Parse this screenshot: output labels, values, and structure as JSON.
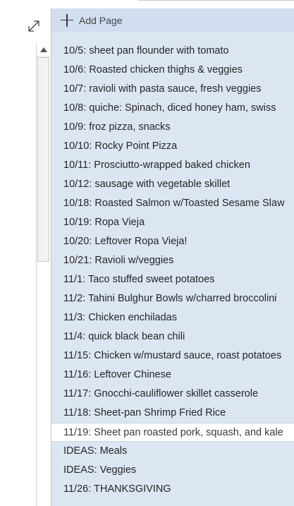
{
  "toolbar": {
    "add_page_label": "Add Page",
    "expand_icon": "expand-diagonal-arrows-icon"
  },
  "scrollbar": {
    "up_icon": "scroll-up-arrow-icon"
  },
  "pages": [
    {
      "title": "10/5: sheet pan flounder with tomato"
    },
    {
      "title": "10/6: Roasted chicken thighs & veggies"
    },
    {
      "title": "10/7: ravioli with pasta sauce, fresh veggies"
    },
    {
      "title": "10/8: quiche: Spinach, diced honey ham, swiss"
    },
    {
      "title": "10/9: froz pizza, snacks"
    },
    {
      "title": "10/10: Rocky Point Pizza"
    },
    {
      "title": "10/11: Prosciutto-wrapped baked chicken"
    },
    {
      "title": "10/12: sausage with vegetable skillet"
    },
    {
      "title": "10/18: Roasted Salmon w/Toasted Sesame Slaw"
    },
    {
      "title": "10/19: Ropa Vieja"
    },
    {
      "title": "10/20: Leftover Ropa Vieja!"
    },
    {
      "title": "10/21: Ravioli w/veggies"
    },
    {
      "title": "11/1: Taco stuffed sweet potatoes"
    },
    {
      "title": "11/2: Tahini Bulghur Bowls w/charred broccolini"
    },
    {
      "title": "11/3: Chicken enchiladas"
    },
    {
      "title": "11/4: quick black bean chili"
    },
    {
      "title": "11/15: Chicken w/mustard sauce, roast potatoes"
    },
    {
      "title": "11/16: Leftover Chinese"
    },
    {
      "title": "11/17: Gnocchi-cauliflower skillet casserole"
    },
    {
      "title": "11/18: Sheet-pan Shrimp Fried Rice"
    },
    {
      "title": "11/19: Sheet pan roasted pork, squash, and kale",
      "selected": true
    },
    {
      "title": "IDEAS: Meals"
    },
    {
      "title": "IDEAS: Veggies"
    },
    {
      "title": "11/26: THANKSGIVING"
    }
  ],
  "colors": {
    "pane_background": "#dce6f3",
    "add_page_background": "#d0def0",
    "selected_background": "#ffffff"
  }
}
